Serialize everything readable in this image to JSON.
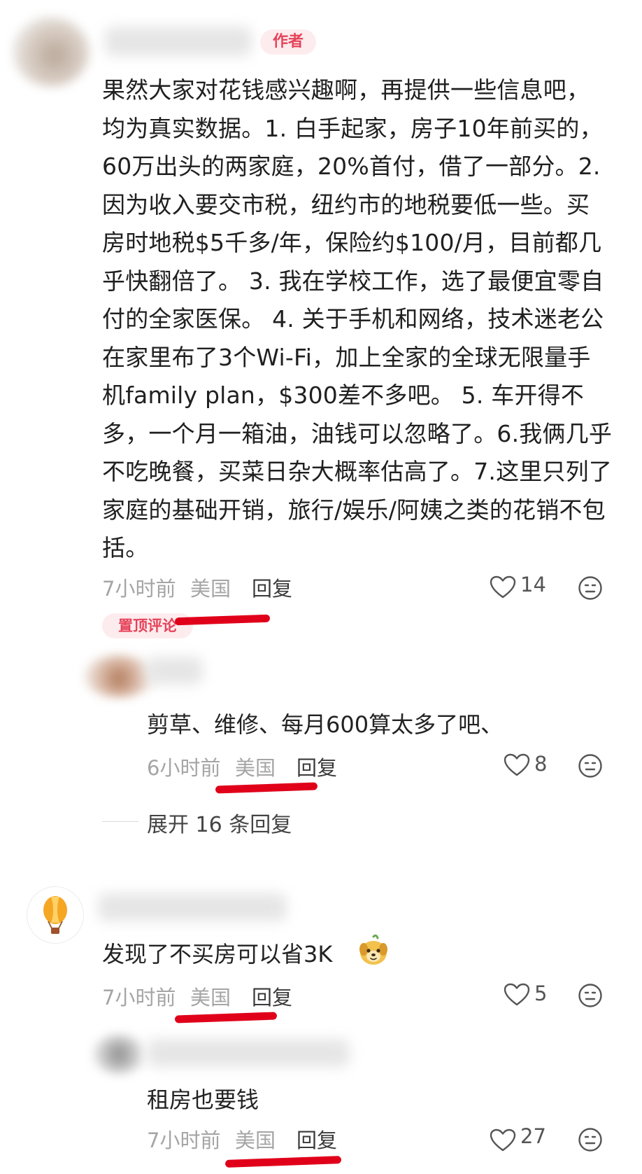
{
  "comment1": {
    "author_tag": "作者",
    "text": "果然大家对花钱感兴趣啊，再提供一些信息吧，均为真实数据。1. 白手起家，房子10年前买的，60万出头的两家庭，20%首付，借了一部分。2. 因为收入要交市税，纽约市的地税要低一些。买房时地税$5千多/年，保险约$100/月，目前都几乎快翻倍了。 3. 我在学校工作，选了最便宜零自付的全家医保。 4. 关于手机和网络，技术迷老公在家里布了3个Wi-Fi，加上全家的全球无限量手机family plan，$300差不多吧。 5. 车开得不多，一个月一箱油，油钱可以忽略了。6.我俩几乎不吃晚餐，买菜日杂大概率估高了。7.这里只列了家庭的基础开销，旅行/娱乐/阿姨之类的花销不包括。",
    "time": "7小时前",
    "location": "美国",
    "reply_label": "回复",
    "likes": "14",
    "pinned_label": "置顶评论"
  },
  "reply1": {
    "text": "剪草、维修、每月600算太多了吧、",
    "time": "6小时前",
    "location": "美国",
    "reply_label": "回复",
    "likes": "8"
  },
  "expand": {
    "label": "展开 16 条回复"
  },
  "comment2": {
    "text": "发现了不买房可以省3K",
    "time": "7小时前",
    "location": "美国",
    "reply_label": "回复",
    "likes": "5"
  },
  "reply2": {
    "text": "租房也要钱",
    "time": "7小时前",
    "location": "美国",
    "reply_label": "回复",
    "likes": "27"
  },
  "colors": {
    "tag_bg": "#fdecee",
    "tag_text": "#e6435a",
    "annotation_red": "#e0001a",
    "meta_gray": "#a5a5a5"
  }
}
